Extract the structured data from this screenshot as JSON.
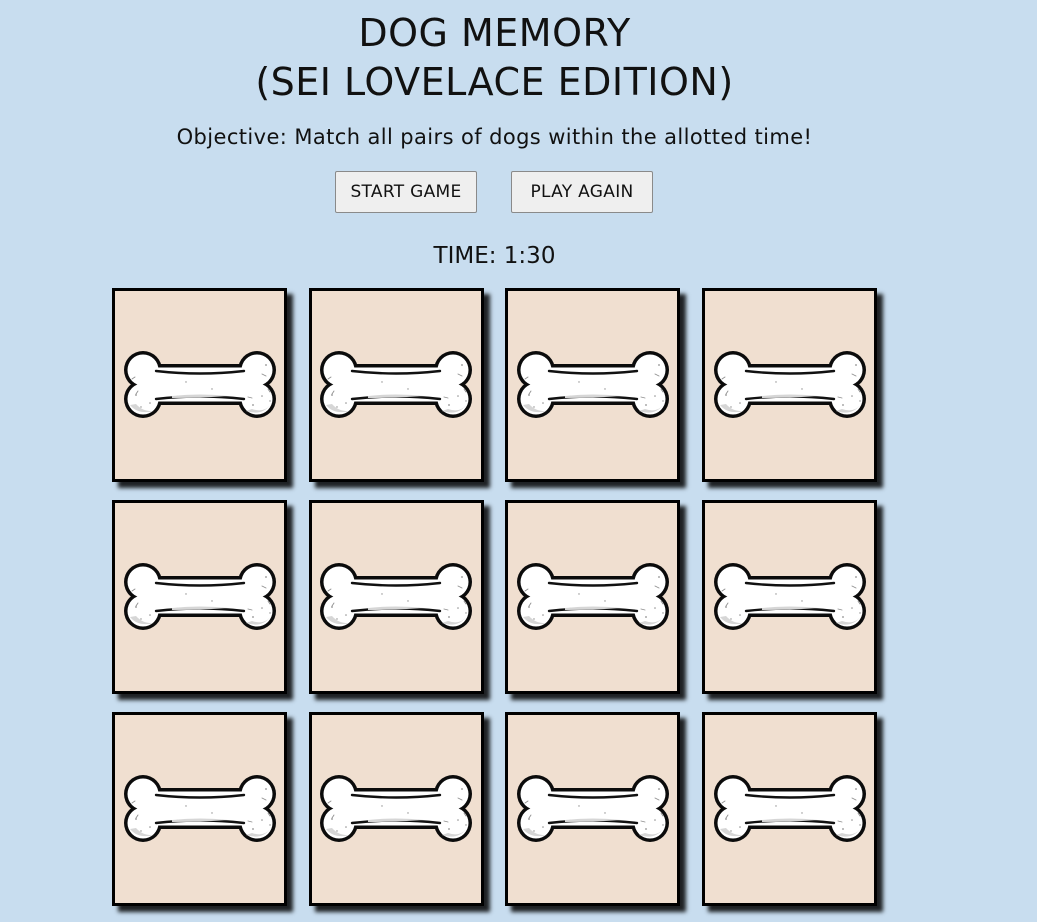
{
  "header": {
    "title_line1": "DOG MEMORY",
    "title_line2": "(SEI LOVELACE EDITION)",
    "objective": "Objective: Match all pairs of dogs within the allotted time!"
  },
  "controls": {
    "start_label": "START GAME",
    "again_label": "PLAY AGAIN"
  },
  "timer": {
    "text": "TIME: 1:30"
  },
  "board": {
    "rows": 3,
    "columns": 4,
    "card_back_icon": "dog-bone-icon",
    "colors": {
      "background": "#c8ddef",
      "card_face": "#f0dfd0",
      "card_border": "#000000",
      "bone_fill": "#ffffff"
    },
    "cards": [
      {
        "state": "face-down"
      },
      {
        "state": "face-down"
      },
      {
        "state": "face-down"
      },
      {
        "state": "face-down"
      },
      {
        "state": "face-down"
      },
      {
        "state": "face-down"
      },
      {
        "state": "face-down"
      },
      {
        "state": "face-down"
      },
      {
        "state": "face-down"
      },
      {
        "state": "face-down"
      },
      {
        "state": "face-down"
      },
      {
        "state": "face-down"
      }
    ]
  }
}
